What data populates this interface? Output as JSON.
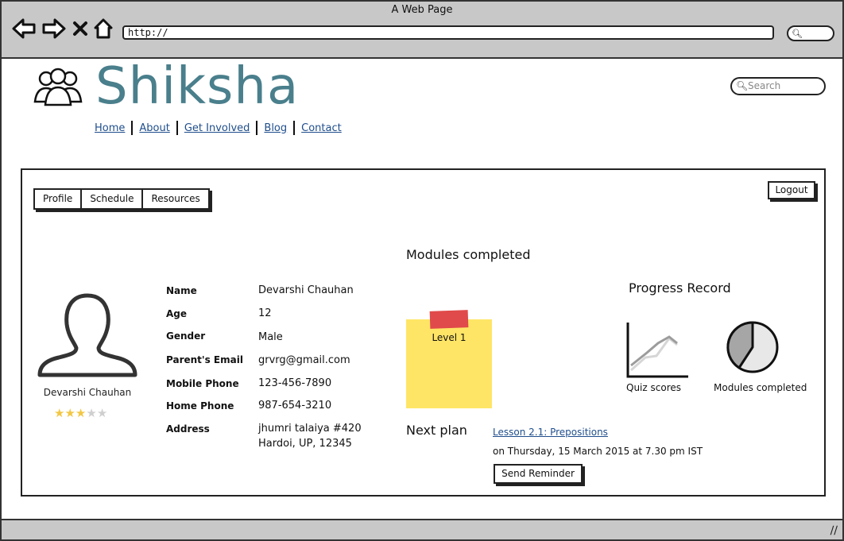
{
  "browser": {
    "window_title": "A Web Page",
    "url": "http://",
    "nav_icons": [
      "back-arrow-icon",
      "forward-arrow-icon",
      "close-icon",
      "home-icon"
    ]
  },
  "header": {
    "site_title": "Shiksha",
    "logo_icon": "people-group-icon",
    "nav": [
      "Home",
      "About",
      "Get Involved",
      "Blog",
      "Contact"
    ],
    "search_placeholder": "Search",
    "accent_color": "#4a7f8c",
    "link_color": "#1f4e8c"
  },
  "panel": {
    "tabs": [
      "Profile",
      "Schedule",
      "Resources"
    ],
    "logout_label": "Logout"
  },
  "profile": {
    "name": "Devarshi Chauhan",
    "rating": 3,
    "rating_max": 5,
    "fields": [
      {
        "label": "Name",
        "value": "Devarshi Chauhan"
      },
      {
        "label": "Age",
        "value": "12"
      },
      {
        "label": "Gender",
        "value": "Male"
      },
      {
        "label": "Parent's Email",
        "value": "grvrg@gmail.com"
      },
      {
        "label": "Mobile Phone",
        "value": "123-456-7890"
      },
      {
        "label": "Home Phone",
        "value": "987-654-3210"
      },
      {
        "label": "Address",
        "value": "jhumri talaiya #420",
        "value2": "Hardoi, UP, 12345"
      }
    ]
  },
  "modules": {
    "heading": "Modules completed",
    "sticky_label": "Level 1",
    "sticky_color": "#ffe566",
    "tape_color": "#e04a4a"
  },
  "next_plan": {
    "heading": "Next plan",
    "lesson": "Lesson 2.1: Prepositions",
    "time": "on Thursday, 15 March 2015 at 7.30 pm IST",
    "button": "Send Reminder"
  },
  "progress": {
    "heading": "Progress Record",
    "quiz_caption": "Quiz scores",
    "pie_caption": "Modules completed"
  }
}
